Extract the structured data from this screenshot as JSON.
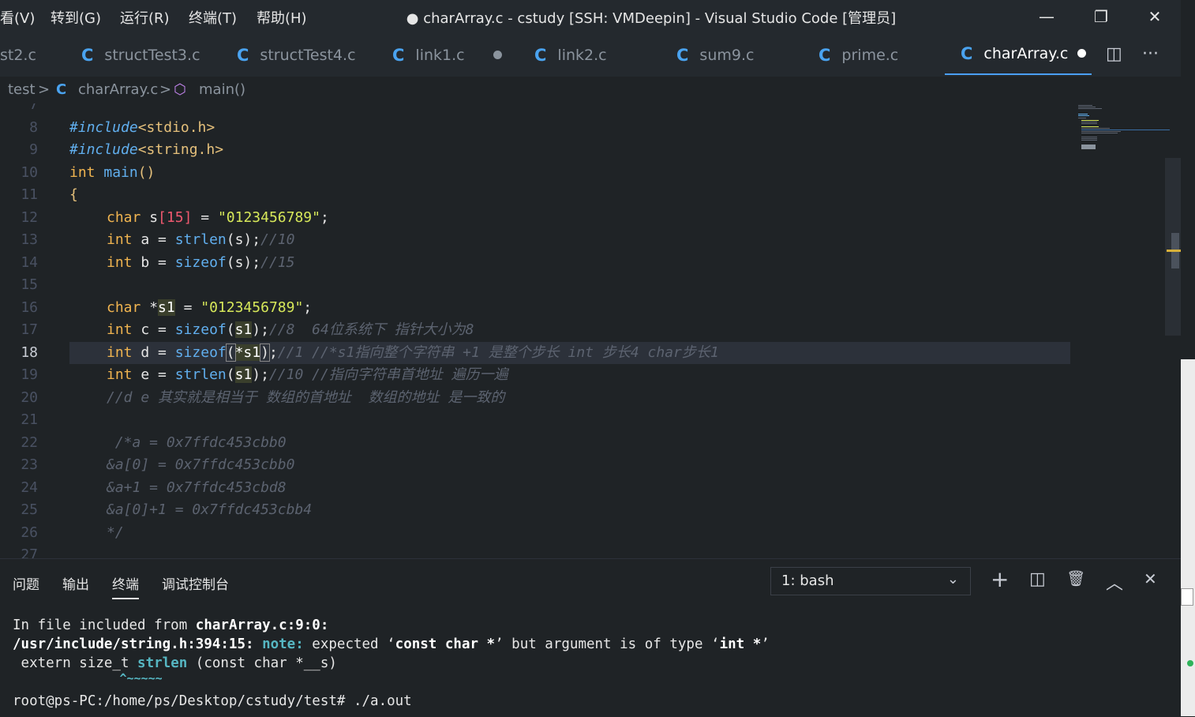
{
  "menu": [
    "看(V)",
    "转到(G)",
    "运行(R)",
    "终端(T)",
    "帮助(H)"
  ],
  "window_title": "● charArray.c - cstudy [SSH: VMDeepin] - Visual Studio Code [管理员]",
  "window_controls": {
    "minimize": "—",
    "maximize": "❐",
    "close": "✕"
  },
  "tabs": [
    {
      "label": "st2.c"
    },
    {
      "label": "structTest3.c"
    },
    {
      "label": "structTest4.c"
    },
    {
      "label": "link1.c"
    },
    {
      "label": "link2.c"
    },
    {
      "label": "sum9.c"
    },
    {
      "label": "prime.c"
    },
    {
      "label": "charArray.c"
    }
  ],
  "tab_icon_letter": "C",
  "tab_actions": {
    "split": "◫",
    "more": "···"
  },
  "breadcrumb": {
    "folder": "test",
    "sep": ">",
    "file": "charArray.c",
    "symbol_icon": "⬡",
    "symbol": "main()"
  },
  "editor": {
    "line_numbers": [
      "7",
      "8",
      "9",
      "10",
      "11",
      "12",
      "13",
      "14",
      "15",
      "16",
      "17",
      "18",
      "19",
      "20",
      "21",
      "22",
      "23",
      "24",
      "25",
      "26",
      "27"
    ],
    "l8": {
      "kw": "#include",
      "rest": "<stdio.h>"
    },
    "l9": {
      "kw": "#include",
      "rest": "<string.h>"
    },
    "l10": {
      "type": "int",
      "name": "main",
      "paren": "()"
    },
    "l11": {
      "brace": "{"
    },
    "l12": {
      "type": "char",
      "var": "s",
      "lb": "[",
      "num": "15",
      "rb": "]",
      "eq": " = ",
      "str": "\"0123456789\"",
      "semi": ";"
    },
    "l13": {
      "type": "int",
      "var": "a",
      "eq": " = ",
      "fn": "strlen",
      "args": "(s)",
      "semi": ";",
      "comment": "//10"
    },
    "l14": {
      "type": "int",
      "var": "b",
      "eq": " = ",
      "fn": "sizeof",
      "args": "(s)",
      "semi": ";",
      "comment": "//15"
    },
    "l16": {
      "type": "char",
      "star": "*",
      "var": "s1",
      "eq": " = ",
      "str": "\"0123456789\"",
      "semi": ";"
    },
    "l17": {
      "type": "int",
      "var": "c",
      "eq": " = ",
      "fn": "sizeof",
      "open": "(",
      "arg": "s1",
      "close": ")",
      "semi": ";",
      "comment": "//8  64位系统下 指针大小为8"
    },
    "l18": {
      "type": "int",
      "var": "d",
      "eq": " = ",
      "fn": "sizeof",
      "open": "(",
      "arg": "*s1",
      "close": ")",
      "semi": ";",
      "comment": "//1 //*s1指向整个字符串 +1 是整个步长 int 步长4 char步长1"
    },
    "l19": {
      "type": "int",
      "var": "e",
      "eq": " = ",
      "fn": "strlen",
      "open": "(",
      "arg": "s1",
      "close": ")",
      "semi": ";",
      "comment": "//10 //指向字符串首地址 遍历一遍"
    },
    "l20": {
      "comment": "//d e 其实就是相当于 数组的首地址  数组的地址 是一致的"
    },
    "l22": {
      "comment": " /*a = 0x7ffdc453cbb0"
    },
    "l23": {
      "comment": "&a[0] = 0x7ffdc453cbb0"
    },
    "l24": {
      "comment": "&a+1 = 0x7ffdc453cbd8"
    },
    "l25": {
      "comment": "&a[0]+1 = 0x7ffdc453cbb4"
    },
    "l26": {
      "comment": "*/"
    }
  },
  "panel": {
    "tabs": [
      "问题",
      "输出",
      "终端",
      "调试控制台"
    ],
    "active_tab": "终端",
    "terminal_select": "1: bash",
    "chevron": "⌄",
    "actions": {
      "add": "+",
      "split": "◫",
      "trash": "🗑",
      "maximize": "︿",
      "close": "✕"
    }
  },
  "terminal": {
    "l1_a": "In file included from ",
    "l1_b": "charArray.c:9:0:",
    "l2_a": "/usr/include/string.h:394:15: ",
    "l2_b": "note: ",
    "l2_c": "expected ‘",
    "l2_d": "const char *",
    "l2_e": "’ but argument is of type ‘",
    "l2_f": "int *",
    "l2_g": "’",
    "l3_a": " extern size_t ",
    "l3_b": "strlen",
    "l3_c": " (const char *__s)",
    "l4": "               ^~~~~~",
    "l5": "root@ps-PC:/home/ps/Desktop/cstudy/test# ./a.out"
  },
  "colors": {
    "background": "#1f2326",
    "accent": "#4a9ff5",
    "keyword": "#f0b450",
    "string": "#d7e85a"
  }
}
